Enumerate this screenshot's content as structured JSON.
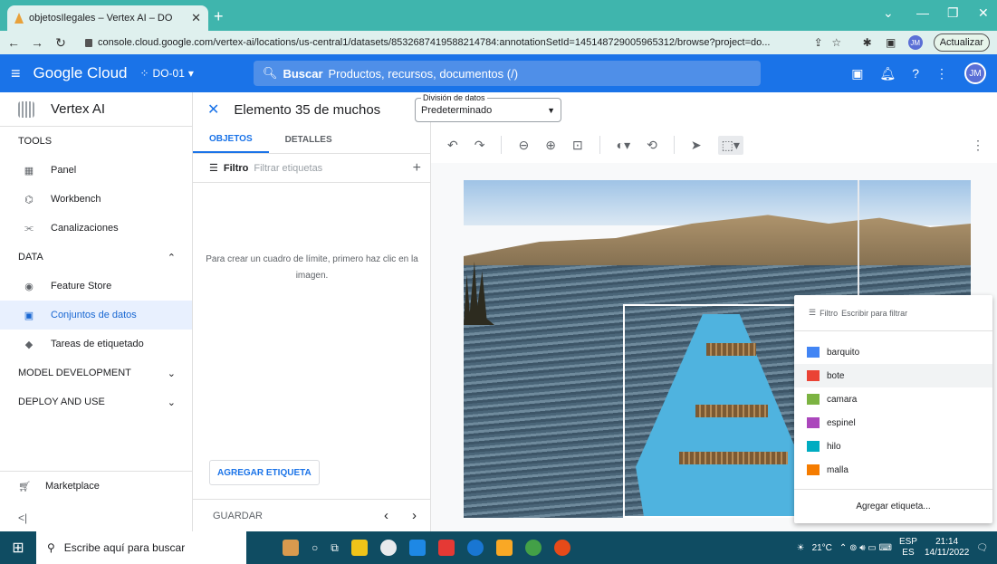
{
  "browser": {
    "tab_title": "objetosIlegales – Vertex AI – DO",
    "url": "console.cloud.google.com/vertex-ai/locations/us-central1/datasets/8532687419588214784:annotationSetId=145148729005965312/browse?project=do...",
    "update_label": "Actualizar",
    "avatar_initials": "JM"
  },
  "gcp": {
    "logo": "Google Cloud",
    "project": "DO-01",
    "search_bold": "Buscar",
    "search_rest": "Productos, recursos, documentos (/)",
    "account_initials": "JM",
    "accent": "#1a73e8"
  },
  "leftnav": {
    "product": "Vertex AI",
    "sections": {
      "tools": "TOOLS",
      "data": "DATA",
      "model_dev": "MODEL DEVELOPMENT",
      "deploy": "DEPLOY AND USE"
    },
    "tools_items": [
      "Panel",
      "Workbench",
      "Canalizaciones"
    ],
    "data_items": [
      "Feature Store",
      "Conjuntos de datos",
      "Tareas de etiquetado"
    ],
    "marketplace": "Marketplace"
  },
  "panel": {
    "title": "Elemento 35 de muchos",
    "tabs": [
      "OBJETOS",
      "DETALLES"
    ],
    "filter_label": "Filtro",
    "filter_placeholder": "Filtrar etiquetas",
    "hint": "Para crear un cuadro de límite, primero haz clic en la imagen.",
    "add_label": "AGREGAR ETIQUETA",
    "save": "GUARDAR"
  },
  "split": {
    "legend": "División de datos",
    "value": "Predeterminado"
  },
  "label_menu": {
    "filter_label": "Filtro",
    "filter_placeholder": "Escribir para filtrar",
    "labels": [
      {
        "name": "barquito",
        "color": "#4285f4"
      },
      {
        "name": "bote",
        "color": "#ea4335"
      },
      {
        "name": "camara",
        "color": "#7cb342"
      },
      {
        "name": "espinel",
        "color": "#ab47bc"
      },
      {
        "name": "hilo",
        "color": "#00acc1"
      },
      {
        "name": "malla",
        "color": "#f57c00"
      }
    ],
    "add_label": "Agregar etiqueta..."
  },
  "taskbar": {
    "search": "Escribe aquí para buscar",
    "temp": "21°C",
    "lang_top": "ESP",
    "lang_bottom": "ES",
    "time": "21:14",
    "date": "14/11/2022"
  }
}
